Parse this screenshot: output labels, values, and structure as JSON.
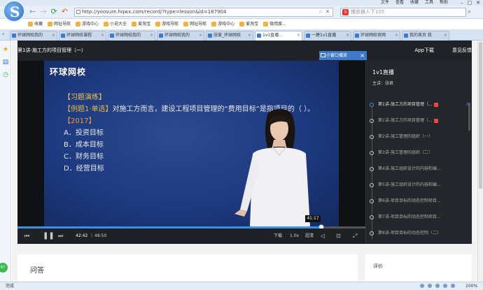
{
  "browser": {
    "menus": [
      "文件",
      "查看",
      "收藏",
      "工具",
      "帮助"
    ],
    "url": "http://yoosure.hqwx.com/record/?type=lesson&id=187904",
    "search_placeholder": "播放器人下105",
    "bookmarks": [
      {
        "label": "收藏"
      },
      {
        "label": "网址导航"
      },
      {
        "label": "游戏中心"
      },
      {
        "label": "小说大全"
      },
      {
        "label": "爱淘宝"
      },
      {
        "label": "游戏导航"
      },
      {
        "label": "网址导航"
      },
      {
        "label": "游戏中心"
      },
      {
        "label": "爱淘宝"
      },
      {
        "label": "微用度..."
      }
    ],
    "tabs": [
      {
        "label": "环球网校我的"
      },
      {
        "label": "环球网校课程"
      },
      {
        "label": "环球网校我的"
      },
      {
        "label": "环球网校我的"
      },
      {
        "label": "张爱_环球网校"
      },
      {
        "label": "1v1直播..."
      },
      {
        "label": "一建1v1直播"
      },
      {
        "label": "环球网校官网"
      },
      {
        "label": "我的首页 我"
      }
    ],
    "active_tab_index": 5,
    "status": "完成",
    "zoom": "100%"
  },
  "course": {
    "title": "第1讲-施工方的项目管理（一）",
    "app_download": "App下载",
    "feedback": "意见反馈"
  },
  "video": {
    "brand": "环球网校",
    "mini_window": "小窗口播放",
    "exercise": {
      "heading": "【习题演练】",
      "question_label": "【例题1·单选】",
      "question_text": "对施工方而言，建设工程项目管理的“费用目标”是指项目的（ ）。",
      "year": "【2017】",
      "options": [
        "A．投资目标",
        "B．成本目标",
        "C．财务目标",
        "D．经营目标"
      ]
    },
    "current_time": "42:42",
    "duration": "48:50",
    "tooltip_time": "41:17",
    "progress": 0.874,
    "download": "下载",
    "speed": "1.0x",
    "quality": "超清"
  },
  "live_panel": {
    "title": "1v1直播",
    "teacher": "主讲：张君",
    "lessons": [
      {
        "title": "第1讲-施工方的项目管理（...",
        "badge": true,
        "active": true
      },
      {
        "title": "第1讲-施工方的项目管理（...",
        "badge": true,
        "active": false
      },
      {
        "title": "第2讲-施工管理的组织（一）",
        "badge": false,
        "active": false
      },
      {
        "title": "第3讲-施工管理的组织（二）",
        "badge": false,
        "active": false
      },
      {
        "title": "第4讲-施工组织设计的内容和编...",
        "badge": false,
        "active": false
      },
      {
        "title": "第5讲-施工组织设计的内容和编...",
        "badge": false,
        "active": false
      },
      {
        "title": "第6讲-项目目标的动态控制项目...",
        "badge": false,
        "active": false
      },
      {
        "title": "第7讲-项目目标的动态控制项目...",
        "badge": false,
        "active": false
      },
      {
        "title": "第8讲-项目目标的动态控制（二）",
        "badge": false,
        "active": false
      }
    ]
  },
  "qa": {
    "title": "问答"
  },
  "review": {
    "title": "评价"
  }
}
